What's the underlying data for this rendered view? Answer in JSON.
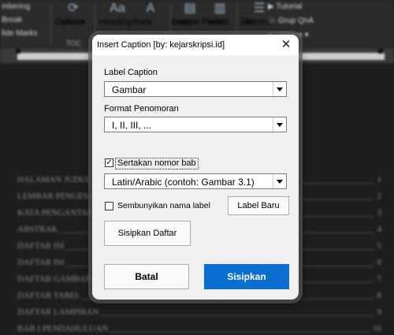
{
  "background_app": {
    "ribbon_left": [
      "mbering",
      "Break",
      "lide Marks"
    ],
    "update_table": {
      "line1": "Update",
      "line2": "Daftar ▾"
    },
    "group_toc": "TOC",
    "heading": "Heading",
    "body": "Body",
    "copy": {
      "line1": "Copy",
      "line2": "Format"
    },
    "paste": {
      "line1": "Paste",
      "line2": "Format"
    },
    "list": {
      "line1": "List",
      "line2": "Shortcut"
    },
    "right_items": [
      "Tutorial",
      "Grup QnA",
      "Lainnya ▾"
    ],
    "toc_rows": [
      {
        "text": "HALAMAN JUDUL",
        "page": "1"
      },
      {
        "text": "LEMBAR PENGESAHAN",
        "page": "2"
      },
      {
        "text": "KATA PENGANTAR",
        "page": "3"
      },
      {
        "text": "ABSTRAK",
        "page": "4"
      },
      {
        "text": "DAFTAR ISI",
        "page": "5"
      },
      {
        "text": "DAFTAR ISI",
        "page": "6"
      },
      {
        "text": "DAFTAR GAMBAR",
        "page": "7"
      },
      {
        "text": "DAFTAR TABEL",
        "page": "8"
      },
      {
        "text": "DAFTAR LAMPIRAN",
        "page": "9"
      },
      {
        "text": "BAB I PENDAHULUAN",
        "page": "10"
      }
    ]
  },
  "dialog": {
    "title": "Insert Caption [by: kejarskripsi.id]",
    "close_glyph": "✕",
    "label_caption": {
      "label": "Label Caption",
      "value": "Gambar"
    },
    "format_penomoran": {
      "label": "Format Penomoran",
      "value": "I, II, III, ..."
    },
    "sertakan_nomor_bab": {
      "label": "Sertakan nomor bab",
      "checked": true,
      "check_glyph": "✓"
    },
    "chapter_format": {
      "value": "Latin/Arabic (contoh: Gambar 3.1)"
    },
    "sembunyikan_nama_label": {
      "label": "Sembunyikan nama label",
      "checked": false
    },
    "label_baru_button": "Label Baru",
    "sisipkan_daftar_button": "Sisipkan Daftar",
    "batal_button": "Batal",
    "sisipkan_button": "Sisipkan",
    "colors": {
      "primary": "#0a6ed1",
      "titlebar": "#ffffff",
      "body": "#f0f0f0"
    }
  }
}
